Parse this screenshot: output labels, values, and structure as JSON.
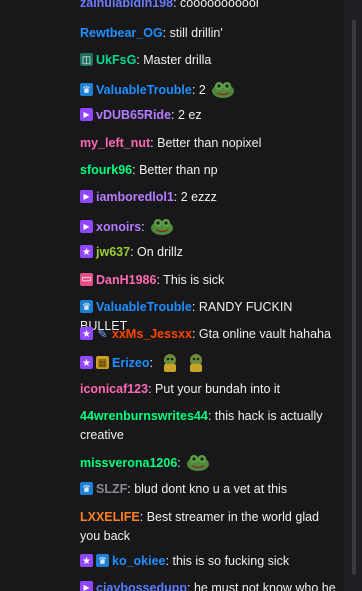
{
  "messages": [
    {
      "user": "zainulabidin198",
      "color": "#6b7cff",
      "badges": [],
      "sep": ":",
      "text": " cooooooooool",
      "emotes": []
    },
    {
      "user": "Rewtbear_OG",
      "color": "#1e90ff",
      "badges": [],
      "sep": ":",
      "text": " still drillin'",
      "emotes": []
    },
    {
      "user": "UkFsG",
      "color": "#00d98b",
      "badges": [
        "app"
      ],
      "sep": ":",
      "text": " Master drilla",
      "emotes": []
    },
    {
      "user": "ValuableTrouble",
      "color": "#1e90ff",
      "badges": [
        "crown"
      ],
      "sep": ":",
      "text": " 2",
      "emotes": [
        "frog-emote"
      ]
    },
    {
      "user": "vDUB65Ride",
      "color": "#b57cff",
      "badges": [
        "prime"
      ],
      "sep": ":",
      "text": " 2 ez",
      "emotes": []
    },
    {
      "user": "my_left_nut",
      "color": "#ff69b4",
      "badges": [],
      "sep": ":",
      "text": " Better than nopixel",
      "emotes": []
    },
    {
      "user": "sfourk96",
      "color": "#00ff7f",
      "badges": [],
      "sep": ":",
      "text": " Better than np",
      "emotes": []
    },
    {
      "user": "iamboredlol1",
      "color": "#b57cff",
      "badges": [
        "prime"
      ],
      "sep": ":",
      "text": " 2 ezzz",
      "emotes": []
    },
    {
      "user": "xonoirs",
      "color": "#b57cff",
      "badges": [
        "prime"
      ],
      "sep": ":",
      "text": "",
      "emotes": [
        "frog-emote"
      ]
    },
    {
      "user": "jw637",
      "color": "#9acd32",
      "badges": [
        "star"
      ],
      "sep": ":",
      "text": " On drillz",
      "emotes": []
    },
    {
      "user": "DanH1986",
      "color": "#ff69b4",
      "badges": [
        "ticket"
      ],
      "sep": ":",
      "text": " This is sick",
      "emotes": []
    },
    {
      "user": "ValuableTrouble",
      "color": "#1e90ff",
      "badges": [
        "crown"
      ],
      "sep": ":",
      "text": " RANDY FUCKIN BULLET",
      "emotes": []
    },
    {
      "user": "xxMs_Jessxx",
      "color": "#ff4500",
      "badges": [
        "star",
        "pencil"
      ],
      "sep": ":",
      "text": " Gta online vault hahaha",
      "emotes": []
    },
    {
      "user": "Erizeo",
      "color": "#1e90ff",
      "badges": [
        "star",
        "bits"
      ],
      "sep": ":",
      "text": "",
      "emotes": [
        "pepe-emote",
        "pepe-emote"
      ]
    },
    {
      "user": "iconicaf123",
      "color": "#ff69b4",
      "badges": [],
      "sep": ":",
      "text": " Put your bundah into it",
      "emotes": []
    },
    {
      "user": "44wrenburnswrites44",
      "color": "#00ff7f",
      "badges": [],
      "sep": ":",
      "text": " this hack is actually creative",
      "emotes": []
    },
    {
      "user": "missverona1206",
      "color": "#00ff7f",
      "badges": [],
      "sep": ":",
      "text": "",
      "emotes": [
        "frog-emote"
      ]
    },
    {
      "user": "SLZF",
      "color": "#8a8a8f",
      "badges": [
        "crown"
      ],
      "sep": ":",
      "text": " blud dont kno u a vet at this",
      "emotes": []
    },
    {
      "user": "LXXELIFE",
      "color": "#ff7f24",
      "badges": [],
      "sep": ":",
      "text": " Best streamer in the world glad you back",
      "emotes": []
    },
    {
      "user": "ko_okiee",
      "color": "#1e90ff",
      "badges": [
        "star",
        "crown"
      ],
      "sep": ":",
      "text": " this is so fucking sick",
      "emotes": []
    },
    {
      "user": "ciaybossedupp",
      "color": "#5a7cff",
      "badges": [
        "prime"
      ],
      "sep": ":",
      "text": " he must not know who he",
      "emotes": []
    }
  ],
  "colors": {
    "background": "#18181b",
    "text": "#efeff1",
    "badge_purple": "#9146ff"
  }
}
